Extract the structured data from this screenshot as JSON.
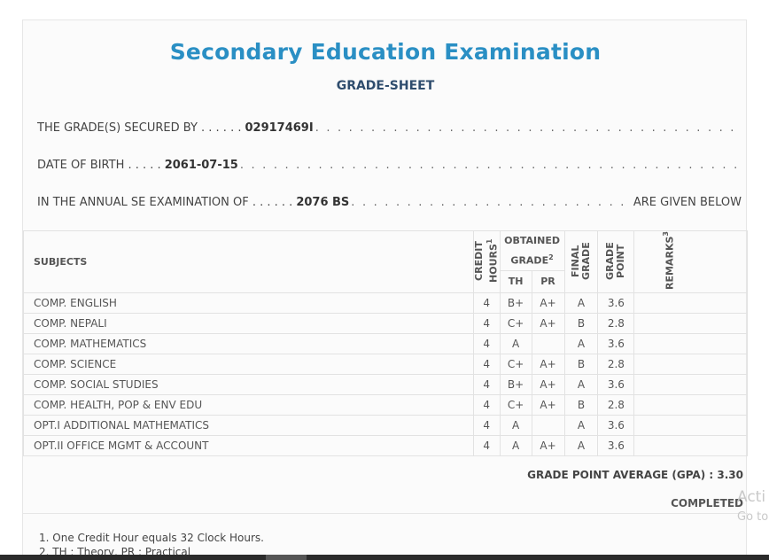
{
  "header": {
    "title": "Secondary Education Examination",
    "subtitle": "GRADE-SHEET"
  },
  "student": {
    "secured_by_label": "THE GRADE(S) SECURED BY . . . . . .",
    "symbol_no": "02917469I",
    "dob_label": "DATE OF BIRTH . . . . .",
    "dob": "2061-07-15",
    "exam_label": "IN THE ANNUAL SE EXAMINATION OF . . . . . .",
    "exam_year": "2076 BS",
    "exam_tail": "ARE GIVEN BELOW"
  },
  "table": {
    "headers": {
      "subjects": "SUBJECTS",
      "credit_hours": "CREDIT HOURS",
      "credit_hours_note": "1",
      "obtained_grade": "OBTAINED GRADE",
      "obtained_grade_note": "2",
      "th": "TH",
      "pr": "PR",
      "final_grade": "FINAL GRADE",
      "grade_point": "GRADE POINT",
      "remarks": "REMARKS",
      "remarks_note": "3"
    },
    "rows": [
      {
        "subject": "COMP. ENGLISH",
        "credit": "4",
        "th": "B+",
        "pr": "A+",
        "final": "A",
        "gp": "3.6",
        "remarks": ""
      },
      {
        "subject": "COMP. NEPALI",
        "credit": "4",
        "th": "C+",
        "pr": "A+",
        "final": "B",
        "gp": "2.8",
        "remarks": ""
      },
      {
        "subject": "COMP. MATHEMATICS",
        "credit": "4",
        "th": "A",
        "pr": "",
        "final": "A",
        "gp": "3.6",
        "remarks": ""
      },
      {
        "subject": "COMP. SCIENCE",
        "credit": "4",
        "th": "C+",
        "pr": "A+",
        "final": "B",
        "gp": "2.8",
        "remarks": ""
      },
      {
        "subject": "COMP. SOCIAL STUDIES",
        "credit": "4",
        "th": "B+",
        "pr": "A+",
        "final": "A",
        "gp": "3.6",
        "remarks": ""
      },
      {
        "subject": "COMP. HEALTH, POP & ENV EDU",
        "credit": "4",
        "th": "C+",
        "pr": "A+",
        "final": "B",
        "gp": "2.8",
        "remarks": ""
      },
      {
        "subject": "OPT.I ADDITIONAL MATHEMATICS",
        "credit": "4",
        "th": "A",
        "pr": "",
        "final": "A",
        "gp": "3.6",
        "remarks": ""
      },
      {
        "subject": "OPT.II OFFICE MGMT & ACCOUNT",
        "credit": "4",
        "th": "A",
        "pr": "A+",
        "final": "A",
        "gp": "3.6",
        "remarks": ""
      }
    ]
  },
  "summary": {
    "gpa_label": "GRADE POINT AVERAGE (GPA) :",
    "gpa_value": "3.30",
    "status": "COMPLETED"
  },
  "notes": [
    "1. One Credit Hour equals 32 Clock Hours.",
    "2. TH : Theory, PR : Practical"
  ],
  "watermark": {
    "line1": "Acti",
    "line2": "Go to"
  }
}
